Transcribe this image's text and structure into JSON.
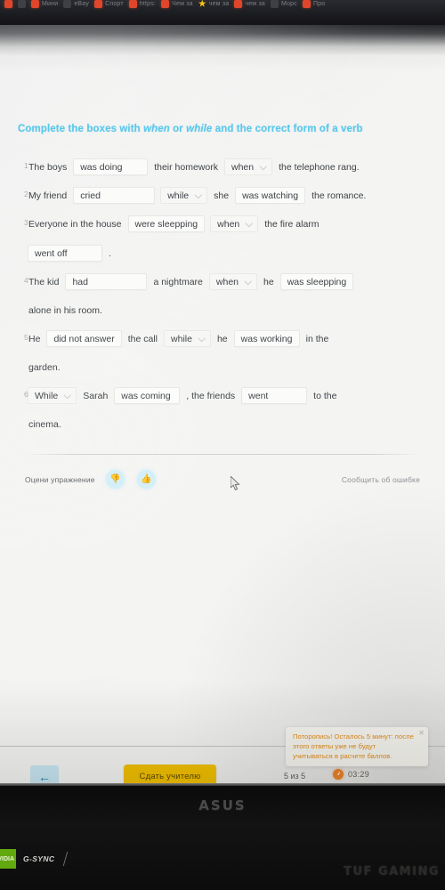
{
  "browser": {
    "bookmarks": [
      {
        "label": "",
        "icon": "red-favicon"
      },
      {
        "label": "",
        "icon": "dark-favicon"
      },
      {
        "label": "Мини",
        "icon": "red-favicon"
      },
      {
        "label": "eBay",
        "icon": "dark-favicon"
      },
      {
        "label": "Спорт",
        "icon": "red-favicon"
      },
      {
        "label": "https:",
        "icon": "red-favicon"
      },
      {
        "label": "Чем за",
        "icon": "red-favicon"
      },
      {
        "label": "чем за",
        "icon": "star-favicon"
      },
      {
        "label": "чем за",
        "icon": "red-favicon"
      },
      {
        "label": "Морс",
        "icon": "dark-favicon"
      },
      {
        "label": "Про",
        "icon": "red-favicon"
      }
    ]
  },
  "exercise": {
    "title_part1": "Complete the boxes with ",
    "title_when": "when",
    "title_or": " or ",
    "title_while": "while",
    "title_part2": " and the correct form of a verb",
    "title_color": "#57c7ec",
    "questions": [
      {
        "num": "1",
        "parts": [
          {
            "type": "text",
            "value": "The boys"
          },
          {
            "type": "field",
            "value": "was doing",
            "width": "w-lg"
          },
          {
            "type": "text",
            "value": "their homework"
          },
          {
            "type": "select",
            "value": "when"
          },
          {
            "type": "text",
            "value": "the telephone rang."
          }
        ]
      },
      {
        "num": "2",
        "parts": [
          {
            "type": "text",
            "value": "My friend"
          },
          {
            "type": "field",
            "value": "cried",
            "width": "w-xl"
          },
          {
            "type": "select",
            "value": "while"
          },
          {
            "type": "text",
            "value": "she"
          },
          {
            "type": "field",
            "value": "was watching",
            "width": "w-md"
          },
          {
            "type": "text",
            "value": "the romance."
          }
        ]
      },
      {
        "num": "3",
        "parts": [
          {
            "type": "text",
            "value": "Everyone in the house"
          },
          {
            "type": "field",
            "value": "were sleepping",
            "width": "w-md"
          },
          {
            "type": "select",
            "value": "when"
          },
          {
            "type": "text",
            "value": "the fire alarm"
          },
          {
            "type": "break"
          },
          {
            "type": "field",
            "value": "went off",
            "width": "w-lg"
          },
          {
            "type": "text",
            "value": "."
          }
        ]
      },
      {
        "num": "4",
        "parts": [
          {
            "type": "text",
            "value": "The kid"
          },
          {
            "type": "field",
            "value": "had",
            "width": "w-xl"
          },
          {
            "type": "text",
            "value": "a nightmare"
          },
          {
            "type": "select",
            "value": "when"
          },
          {
            "type": "text",
            "value": "he"
          },
          {
            "type": "field",
            "value": "was sleepping",
            "width": "w-md"
          },
          {
            "type": "break"
          },
          {
            "type": "text",
            "value": "alone in his room."
          }
        ]
      },
      {
        "num": "5",
        "parts": [
          {
            "type": "text",
            "value": "He"
          },
          {
            "type": "field",
            "value": "did not answer",
            "width": "w-md"
          },
          {
            "type": "text",
            "value": "the call"
          },
          {
            "type": "select",
            "value": "while"
          },
          {
            "type": "text",
            "value": "he"
          },
          {
            "type": "field",
            "value": "was working",
            "width": "w-md"
          },
          {
            "type": "text",
            "value": "in the"
          },
          {
            "type": "break"
          },
          {
            "type": "text",
            "value": "garden."
          }
        ]
      },
      {
        "num": "6",
        "parts": [
          {
            "type": "select",
            "value": "While"
          },
          {
            "type": "text",
            "value": "Sarah"
          },
          {
            "type": "field",
            "value": "was coming",
            "width": "w-md"
          },
          {
            "type": "text",
            "value": ", the friends"
          },
          {
            "type": "field",
            "value": "went",
            "width": "w-md"
          },
          {
            "type": "text",
            "value": "to the"
          },
          {
            "type": "break"
          },
          {
            "type": "text",
            "value": "cinema."
          }
        ]
      }
    ]
  },
  "rating": {
    "label": "Оцени упражнение",
    "thumb_down": "👎",
    "thumb_up": "👍",
    "report_label": "Сообщить об ошибке",
    "accent_color": "#2aa8dd"
  },
  "toolbar": {
    "back_icon": "←",
    "submit_label": "Сдать учителю",
    "submit_color": "#f2c000",
    "counter": "5 из 5",
    "timer_value": "03:29",
    "timer_color": "#e8822a"
  },
  "tooltip": {
    "text": "Поторопись! Осталось 5 минут: после этого ответы уже не будут учитываться в расчете баллов.",
    "close_icon": "✕",
    "text_color": "#e08a17"
  },
  "device": {
    "brand": "ASUS",
    "gsync_badge": "VIDIA",
    "gsync_label": "G-SYNC",
    "series": "TUF GAMING"
  }
}
